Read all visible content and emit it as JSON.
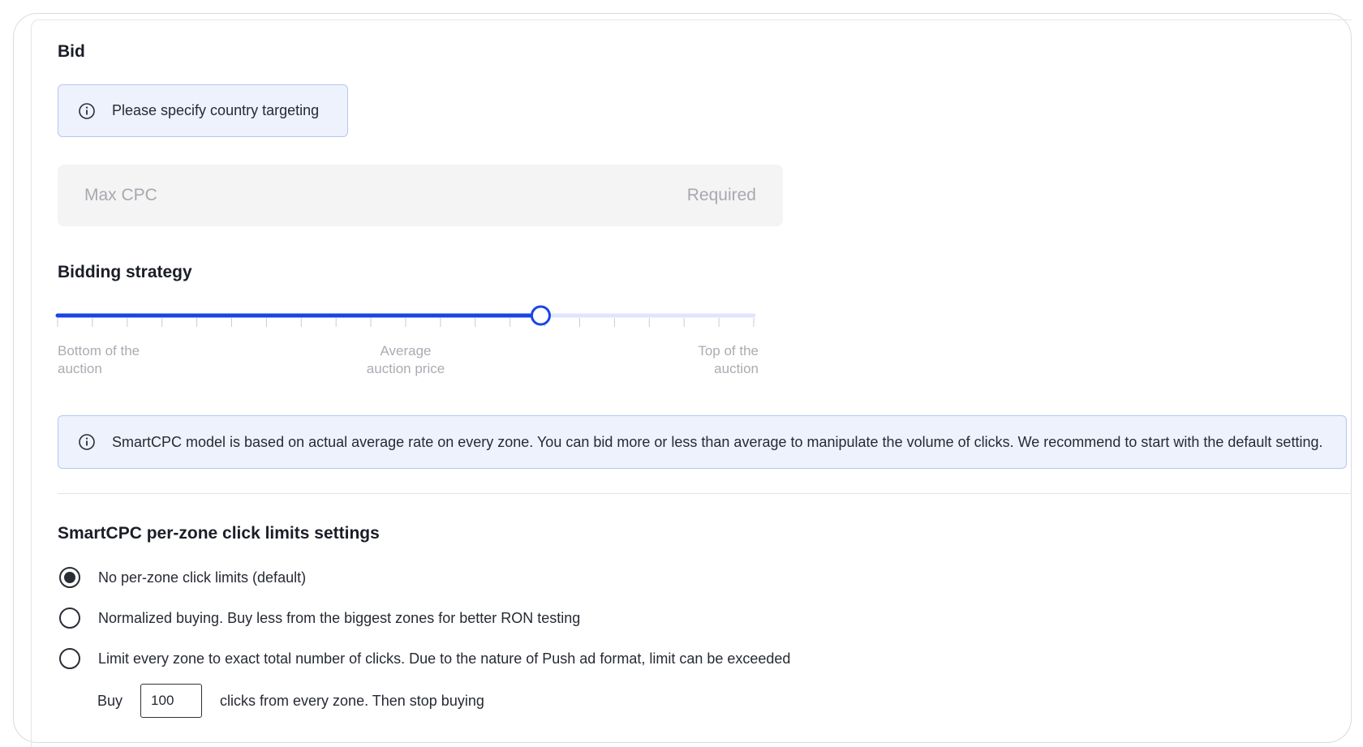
{
  "bid": {
    "heading": "Bid",
    "country_notice": "Please specify country targeting",
    "max_cpc": {
      "placeholder": "Max CPC",
      "required_label": "Required",
      "value": ""
    }
  },
  "bidding_strategy": {
    "heading": "Bidding strategy",
    "slider": {
      "value_fraction": 0.694,
      "tick_count": 21,
      "label_low": [
        "Bottom of the",
        "auction"
      ],
      "label_mid": [
        "Average",
        "auction price"
      ],
      "label_high": [
        "Top of the",
        "auction"
      ]
    },
    "info_text": "SmartCPC model is based on actual average rate on every zone. You can bid more or less than average to manipulate the volume of clicks. We recommend to start with the default setting."
  },
  "click_limits": {
    "heading": "SmartCPC per-zone click limits settings",
    "options": [
      {
        "label": "No per-zone click limits (default)",
        "selected": true
      },
      {
        "label": "Normalized buying. Buy less from the biggest zones for better RON testing",
        "selected": false
      },
      {
        "label": "Limit every zone to exact total number of clicks. Due to the nature of Push ad format, limit can be exceeded",
        "selected": false
      }
    ],
    "buy": {
      "prefix": "Buy",
      "value": "100",
      "suffix": "clicks from every zone. Then stop buying"
    }
  },
  "colors": {
    "accent": "#1a44e6",
    "track_inactive": "#dfe6fb",
    "info_bg": "#eef2fd",
    "info_border": "#b7c6f1"
  }
}
